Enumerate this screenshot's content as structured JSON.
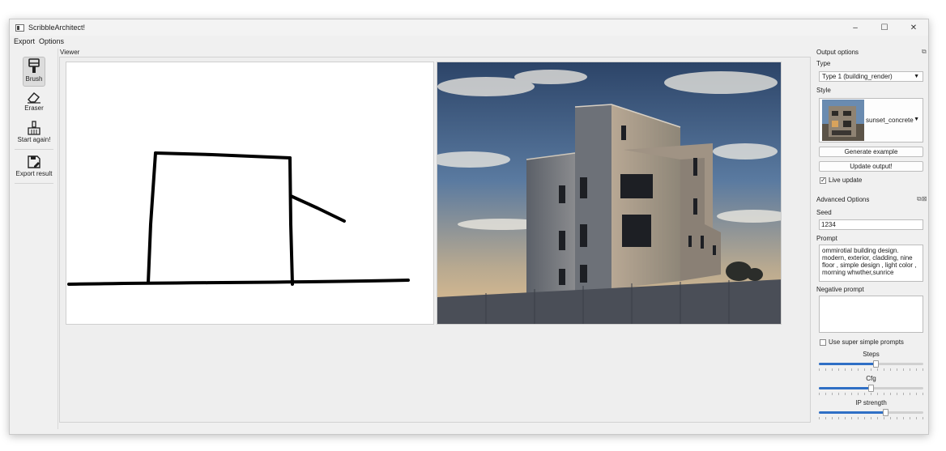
{
  "window": {
    "title": "ScribbleArchitect!",
    "controls": [
      "–",
      "☐",
      "✕"
    ]
  },
  "menu": [
    "Export",
    "Options"
  ],
  "toolbar": {
    "brush": "Brush",
    "eraser": "Eraser",
    "start_again": "Start again!",
    "export_result": "Export result"
  },
  "viewer": {
    "label": "Viewer"
  },
  "output_options": {
    "title": "Output options",
    "type_label": "Type",
    "type_value": "Type 1 (building_render)",
    "style_label": "Style",
    "style_value": "sunset_concrete",
    "generate_example": "Generate example",
    "update_output": "Update output!",
    "live_update_label": "Live update",
    "live_update_checked": true
  },
  "advanced_options": {
    "title": "Advanced Options",
    "seed_label": "Seed",
    "seed_value": "1234",
    "prompt_label": "Prompt",
    "prompt_value": "ommirotial building design. modern, exterior, cladding, nine floor , simple design , light color , morning whwther,sunrice",
    "negative_prompt_label": "Negative prompt",
    "negative_prompt_value": "",
    "super_simple_label": "Use super simple prompts",
    "super_simple_checked": false,
    "steps_label": "Steps",
    "steps_value": 0.55,
    "cfg_label": "Cfg",
    "cfg_value": 0.5,
    "ip_strength_label": "IP strength",
    "ip_strength_value": 0.65
  },
  "colors": {
    "accent": "#2f6fc5",
    "window_bg": "#f0f0f0"
  },
  "icons": {
    "brush": "brush-icon",
    "eraser": "eraser-icon",
    "broom": "broom-icon",
    "export": "export-icon"
  }
}
